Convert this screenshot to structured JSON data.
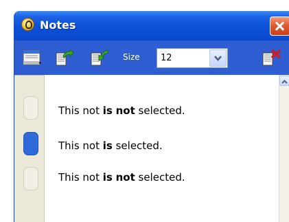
{
  "window": {
    "title": "Notes",
    "close_icon": "close-icon"
  },
  "toolbar": {
    "view_icon": "list-view-icon",
    "export_icon": "export-note-icon",
    "import_icon": "import-note-icon",
    "size_label": "Size",
    "size_value": "12",
    "delete_icon": "delete-note-icon"
  },
  "notes": [
    {
      "prefix": "This not ",
      "emphasis1": "is",
      "middle": " ",
      "emphasis2": "not",
      "suffix": " selected.",
      "selected": false
    },
    {
      "prefix": "This not ",
      "emphasis1": "is",
      "middle": " selected.",
      "selected": true
    },
    {
      "prefix": "This not ",
      "emphasis1": "is",
      "middle": " ",
      "emphasis2": "not",
      "suffix": " selected.",
      "selected": false
    }
  ],
  "colors": {
    "titlebar": "#0a4fd8",
    "toolbar": "#2e5ed1",
    "selected_handle": "#2f6ad8",
    "close_button": "#e05a32"
  }
}
